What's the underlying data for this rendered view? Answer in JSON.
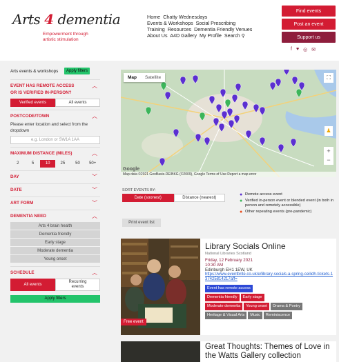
{
  "header": {
    "logo_text_a": "Arts",
    "logo_text_four": "4",
    "logo_text_b": "dementia",
    "logo_tagline_1": "Empowerment through",
    "logo_tagline_2": "artistic stimulation",
    "nav": [
      [
        "Home",
        "Chatty Wednesdays"
      ],
      [
        "Events & Workshops",
        "Social Prescribing"
      ],
      [
        "Training",
        "Resources",
        "Dementia Friendly Venues"
      ],
      [
        "About Us",
        "A4D Gallery",
        "My Profile",
        "Search"
      ]
    ],
    "search_icon": "search-icon",
    "buttons": {
      "find": "Find events",
      "post": "Post an event",
      "support": "Support us"
    },
    "social": [
      "f",
      "♥",
      "◎",
      "✉"
    ]
  },
  "sidebar": {
    "top_label": "Arts events & workshops",
    "apply_small": "Apply filters",
    "remote": {
      "title_1": "EVENT HAS REMOTE ACCESS",
      "title_2": "OR IS VERIFIED IN-PERSON?",
      "opt_a": "Verified events",
      "opt_b": "All events"
    },
    "postcode": {
      "title": "POSTCODE/TOWN",
      "desc": "Please enter location and select from the dropdown",
      "placeholder": "e.g. London or SW1A 1AA"
    },
    "distance": {
      "title": "MAXIMUM DISTANCE (MILES)",
      "options": [
        "2",
        "5",
        "10",
        "25",
        "50",
        "50+"
      ],
      "selected": "10"
    },
    "day": "DAY",
    "date": "DATE",
    "art_form": "ART FORM",
    "dementia_need": {
      "title": "DEMENTIA NEED",
      "options": [
        "Arts 4 brain health",
        "Dementia friendly",
        "Early stage",
        "Moderate dementia",
        "Young onset"
      ]
    },
    "schedule": {
      "title": "SCHEDULE",
      "opt_a": "All events",
      "opt_b_1": "Recurring",
      "opt_b_2": "events"
    },
    "apply_big": "Apply filters"
  },
  "map": {
    "tab_map": "Map",
    "tab_satellite": "Satellite",
    "google": "Google",
    "attribution": "Map data ©2021 GeoBasis-DE/BKG (©2009), Google  Terms of Use  Report a map error",
    "zoom_in": "+",
    "zoom_out": "−",
    "fullscreen_icon": "fullscreen-icon",
    "pegman_icon": "pegman-icon",
    "colors": {
      "land": "#c8dcc0",
      "urban": "#e8e4da",
      "water": "#a9c9ea",
      "pin_purple": "#5b2fd1",
      "pin_green": "#3cb55a"
    }
  },
  "sort": {
    "label": "SORT EVENTS BY:",
    "opt_a": "Date (soonest)",
    "opt_b": "Distance (nearest)"
  },
  "legend": [
    {
      "icon": "purple-pin-icon",
      "color": "#5b2fd1",
      "text": "Remote access event"
    },
    {
      "icon": "green-pin-icon",
      "color": "#3cb55a",
      "text": "Verified in-person event or blended event (in both in person and remotely accessible)"
    },
    {
      "icon": "red-pin-icon",
      "color": "#e84a1a",
      "text": "Other repeating events (pre-pandemic)"
    }
  ],
  "print_label": "Print event list",
  "events": [
    {
      "title": "Library Socials Online",
      "org": "National Libraries Scotland",
      "date_1": "Friday, 12 February 2021",
      "date_2": "10:30 AM",
      "address": "Edinburgh EH1 1EW, UK",
      "link": "https://www.eventbrite.co.uk/e/library-socials-a-spring-ceilidh-tickets-137425814217aff=",
      "badge": "Free event",
      "tags": [
        {
          "text": "Event has remote access",
          "kind": "blue"
        },
        {
          "text": "Dementia friendly",
          "kind": "red"
        },
        {
          "text": "Early stage",
          "kind": "red"
        },
        {
          "text": "Moderate dementia",
          "kind": "red"
        },
        {
          "text": "Young onset",
          "kind": "red"
        },
        {
          "text": "Drama & Poetry",
          "kind": "grey"
        },
        {
          "text": "Heritage & Visual Arts",
          "kind": "grey"
        },
        {
          "text": "Music",
          "kind": "grey"
        },
        {
          "text": "Reminiscence",
          "kind": "grey"
        }
      ]
    },
    {
      "title": "Great Thoughts: Themes of Love in the Watts Gallery collection"
    }
  ]
}
